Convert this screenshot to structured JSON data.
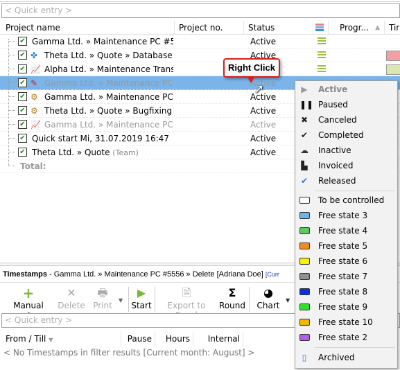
{
  "top": {
    "quick_entry_placeholder": "< Quick entry >"
  },
  "columns": {
    "project_name": "Project name",
    "project_no": "Project no.",
    "status": "Status",
    "progress": "Progr...",
    "time": "Tir"
  },
  "rows": [
    {
      "name": "Gamma Ltd. » Maintenance PC #5556",
      "status": "Active",
      "icon": "none",
      "team": "",
      "muted": false,
      "color": ""
    },
    {
      "name": "Theta Ltd. » Quote » Database an...",
      "status": "Active",
      "icon": "puzzle-icon",
      "team": "",
      "muted": false,
      "color": "#f4a0a0"
    },
    {
      "name": "Alpha Ltd. » Maintenance Transf...",
      "status": "Active",
      "icon": "chart-icon",
      "team": "",
      "muted": false,
      "color": "#d9e8b0"
    },
    {
      "name": "Gamma Ltd. » Maintenance PC #...",
      "status": "Active",
      "icon": "edit-icon",
      "team": "",
      "muted": true,
      "selected": true,
      "color": ""
    },
    {
      "name": "Gamma Ltd. » Maintenance PC #...",
      "status": "Active",
      "icon": "bug-icon",
      "team": "",
      "muted": false,
      "color": ""
    },
    {
      "name": "Theta Ltd. » Quote » Bugfixing",
      "status": "Active",
      "icon": "bug-icon",
      "team": "(Tea",
      "muted": false,
      "color": ""
    },
    {
      "name": "Gamma Ltd. » Maintenance PC #...",
      "status": "Active",
      "icon": "chart-icon",
      "team": "",
      "muted": true,
      "color": ""
    },
    {
      "name": "Quick start Mi, 31.07.2019 16:47",
      "status": "Active",
      "icon": "none",
      "team": "",
      "muted": false,
      "color": ""
    },
    {
      "name": "Theta Ltd. » Quote",
      "status": "Active",
      "icon": "none",
      "team": "(Team)",
      "muted": false,
      "color": ""
    }
  ],
  "total_label": "Total:",
  "callout": {
    "text": "Right Click"
  },
  "menu": {
    "items": [
      {
        "label": "Active",
        "icon": "play-icon",
        "disabled": true
      },
      {
        "label": "Paused",
        "icon": "pause-icon"
      },
      {
        "label": "Canceled",
        "icon": "cancel-icon"
      },
      {
        "label": "Completed",
        "icon": "check-circle-icon"
      },
      {
        "label": "Inactive",
        "icon": "sleep-icon"
      },
      {
        "label": "Invoiced",
        "icon": "invoice-icon"
      },
      {
        "label": "Released",
        "icon": "double-check-icon"
      }
    ],
    "states": [
      {
        "label": "To be controlled",
        "color": "#ffffff"
      },
      {
        "label": "Free state 3",
        "color": "#6fb3e8"
      },
      {
        "label": "Free state 4",
        "color": "#5fc85f"
      },
      {
        "label": "Free state 5",
        "color": "#f08c1a"
      },
      {
        "label": "Free state 6",
        "color": "#f5f500"
      },
      {
        "label": "Free state 7",
        "color": "#909090"
      },
      {
        "label": "Free state 8",
        "color": "#1030e0"
      },
      {
        "label": "Free state 9",
        "color": "#30e030"
      },
      {
        "label": "Free state 10",
        "color": "#f0b800"
      },
      {
        "label": "Free state 2",
        "color": "#b060e0"
      }
    ],
    "archived": "Archived"
  },
  "timestamps": {
    "title": "Timestamps",
    "context": " - Gamma Ltd. » Maintenance PC #5556 » Delete [Adriana Doe]",
    "badge": "[Curr",
    "toolbar": {
      "manual_entry": "Manual entry",
      "delete": "Delete",
      "print": "Print",
      "start": "Start",
      "export": "Export to Excel",
      "round": "Round",
      "chart": "Chart"
    },
    "quick_entry_placeholder": "< Quick entry >",
    "columns": {
      "from_till": "From / Till",
      "pause": "Pause",
      "hours": "Hours",
      "internal": "Internal"
    },
    "empty": "< No Timestamps in filter results [Current month: August] >"
  }
}
